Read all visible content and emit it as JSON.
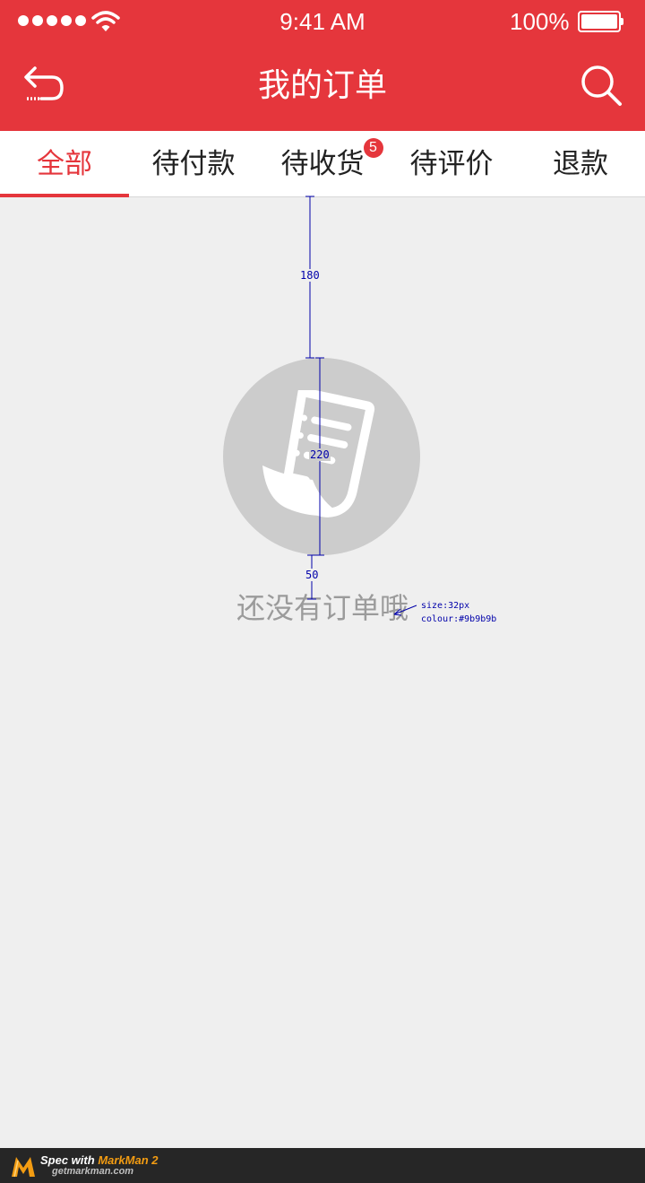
{
  "status_bar": {
    "time": "9:41 AM",
    "battery_percent_label": "100%",
    "battery_level": 1.0,
    "signal_dots": 5,
    "wifi_icon": "wifi-icon"
  },
  "nav": {
    "title": "我的订单",
    "back_icon": "back-arrow-icon",
    "search_icon": "search-icon"
  },
  "tabs": [
    {
      "label": "全部",
      "active": true
    },
    {
      "label": "待付款",
      "active": false
    },
    {
      "label": "待收货",
      "active": false,
      "badge": "5"
    },
    {
      "label": "待评价",
      "active": false
    },
    {
      "label": "退款",
      "active": false
    }
  ],
  "empty_state": {
    "icon": "receipt-icon",
    "message": "还没有订单哦"
  },
  "spec_annotations": {
    "top_gap": "180",
    "icon_diameter": "220",
    "text_gap": "50",
    "text_size": "size:32px",
    "text_colour": "colour:#9b9b9b"
  },
  "footer": {
    "prefix": "Spec with",
    "brand": "MarkMan 2",
    "url": "getmarkman.com"
  },
  "colors": {
    "primary": "#e5363c",
    "background": "#efefef",
    "empty_text": "#9b9b9b",
    "icon_circle": "#cccccc",
    "spec_lines": "#0000aa"
  }
}
